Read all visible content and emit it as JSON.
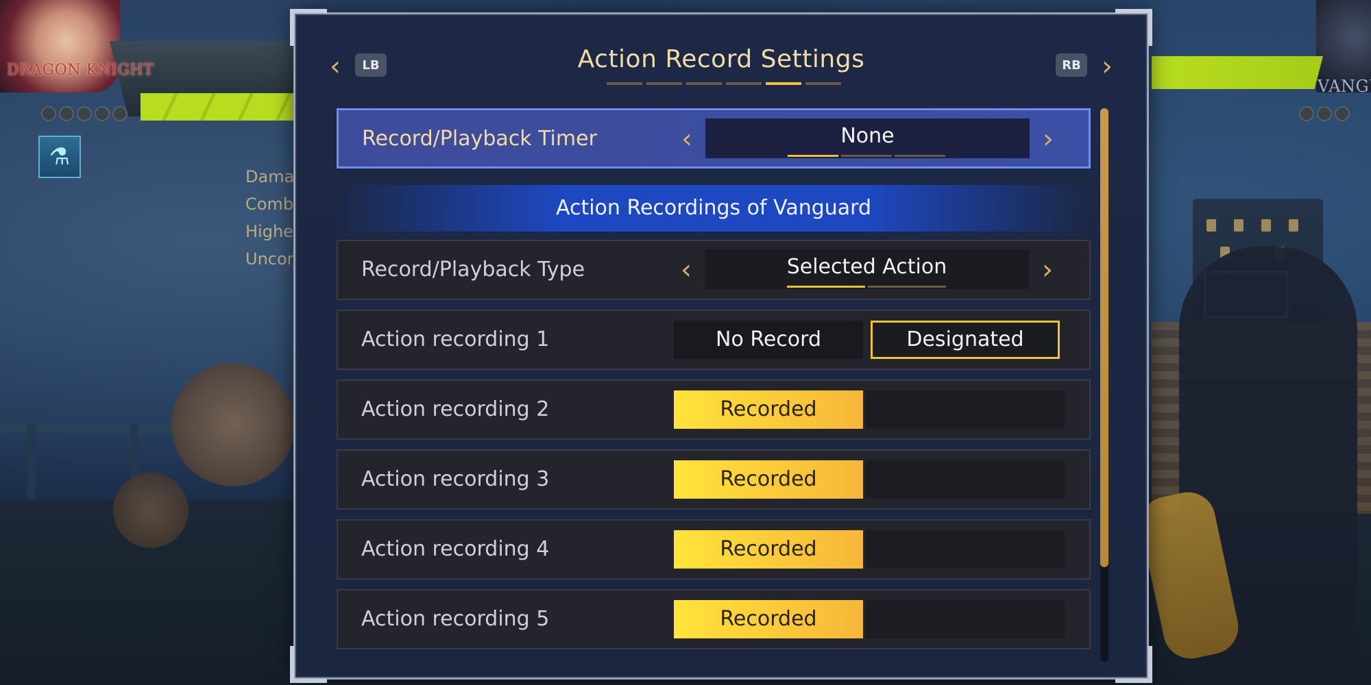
{
  "hud": {
    "player_left_name": "DRAGON KNIGHT",
    "player_right_name": "VANGUA",
    "stats_partial": [
      "Damag",
      "Combo Damage",
      "Highest Combo Damage",
      "Unconscio"
    ],
    "left_meter_count": 5,
    "right_meter_count": 3
  },
  "header": {
    "title": "Action Record Settings",
    "lb_label": "LB",
    "rb_label": "RB",
    "page_count": 6,
    "active_page_index": 4
  },
  "timer_row": {
    "label": "Record/Playback Timer",
    "value": "None",
    "option_ticks": 3,
    "active_tick": 0
  },
  "section": {
    "title": "Action Recordings of Vanguard"
  },
  "type_row": {
    "label": "Record/Playback Type",
    "value": "Selected Action",
    "option_ticks": 2,
    "active_tick": 0
  },
  "recordings": [
    {
      "label": "Action recording 1",
      "option_a": "No Record",
      "option_b": "Designated",
      "state": "designated"
    },
    {
      "label": "Action recording 2",
      "status": "Recorded",
      "state": "recorded"
    },
    {
      "label": "Action recording 3",
      "status": "Recorded",
      "state": "recorded"
    },
    {
      "label": "Action recording 4",
      "status": "Recorded",
      "state": "recorded"
    },
    {
      "label": "Action recording 5",
      "status": "Recorded",
      "state": "recorded"
    }
  ],
  "icons": {
    "nav_left": "chevron-left-icon",
    "nav_right": "chevron-right-icon",
    "skill": "potion-icon"
  },
  "colors": {
    "accent_gold": "#f0c23a",
    "selected_row": "#3d4c9a",
    "section_blue": "#1d48c2",
    "title_text": "#f3dca2"
  }
}
